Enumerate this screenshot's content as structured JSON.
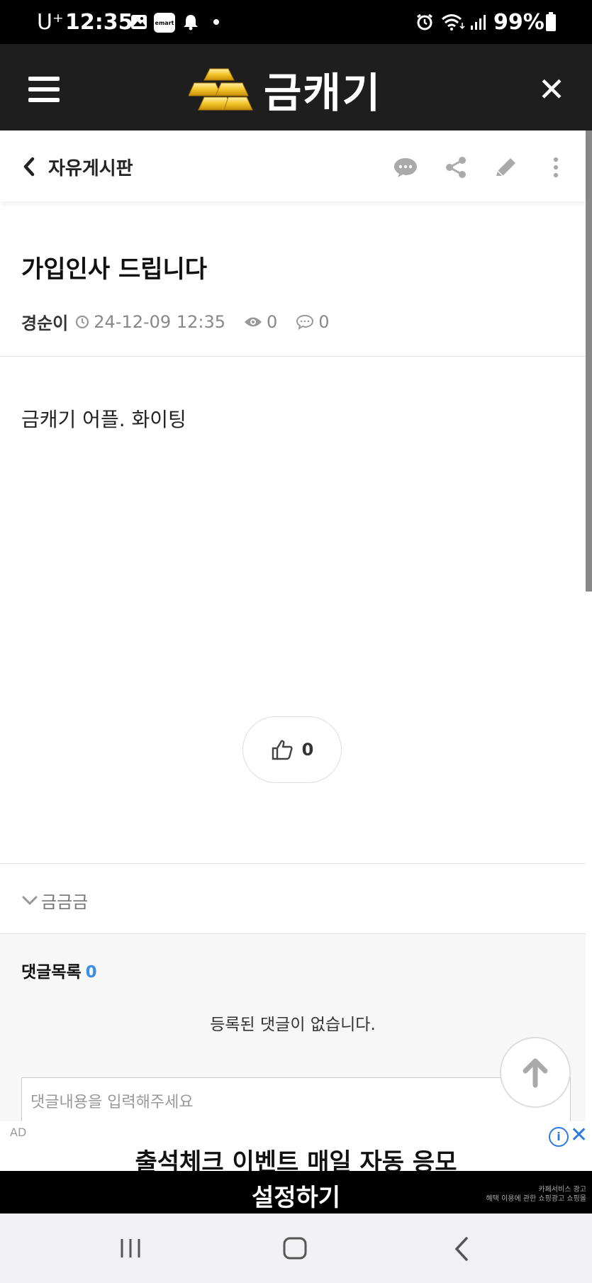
{
  "status_bar": {
    "carrier": "U⁺",
    "time": "12:35",
    "battery": "99%",
    "left_icons": [
      "gallery-icon",
      "emart-icon",
      "bell-icon",
      "dot-icon"
    ],
    "right_icons": [
      "alarm-icon",
      "wifi-icon",
      "signal-icon",
      "battery-icon"
    ],
    "emart_label": "emart"
  },
  "app_header": {
    "title": "금캐기",
    "menu_icon": "hamburger-icon",
    "logo_icon": "gold-bars-icon",
    "close_icon": "close-icon"
  },
  "board_bar": {
    "back_icon": "chevron-left-icon",
    "title": "자유게시판",
    "actions": [
      "comment-icon",
      "share-icon",
      "pencil-icon",
      "more-icon"
    ]
  },
  "post": {
    "title": "가입인사 드립니다",
    "author": "경순이",
    "datetime": "24-12-09 12:35",
    "views": "0",
    "comments": "0",
    "body": "금캐기 어플. 화이팅",
    "likes": "0"
  },
  "tag_row": {
    "label": "금금금"
  },
  "comments": {
    "heading": "댓글목록",
    "count": "0",
    "empty_message": "등록된 댓글이 없습니다.",
    "input_placeholder": "댓글내용을 입력해주세요"
  },
  "ad": {
    "label": "AD",
    "line1": "출석체크 이벤트 매일 자동 응모",
    "line2": "설정하기",
    "fine_print_1": "카페서비스 광고",
    "fine_print_2": "혜택 이용에 관한 쇼핑광고 쇼핑몰"
  },
  "colors": {
    "header_bg": "#1e1e1e",
    "accent_blue": "#3a8ee6",
    "ad_blue": "#2a7ae2"
  }
}
